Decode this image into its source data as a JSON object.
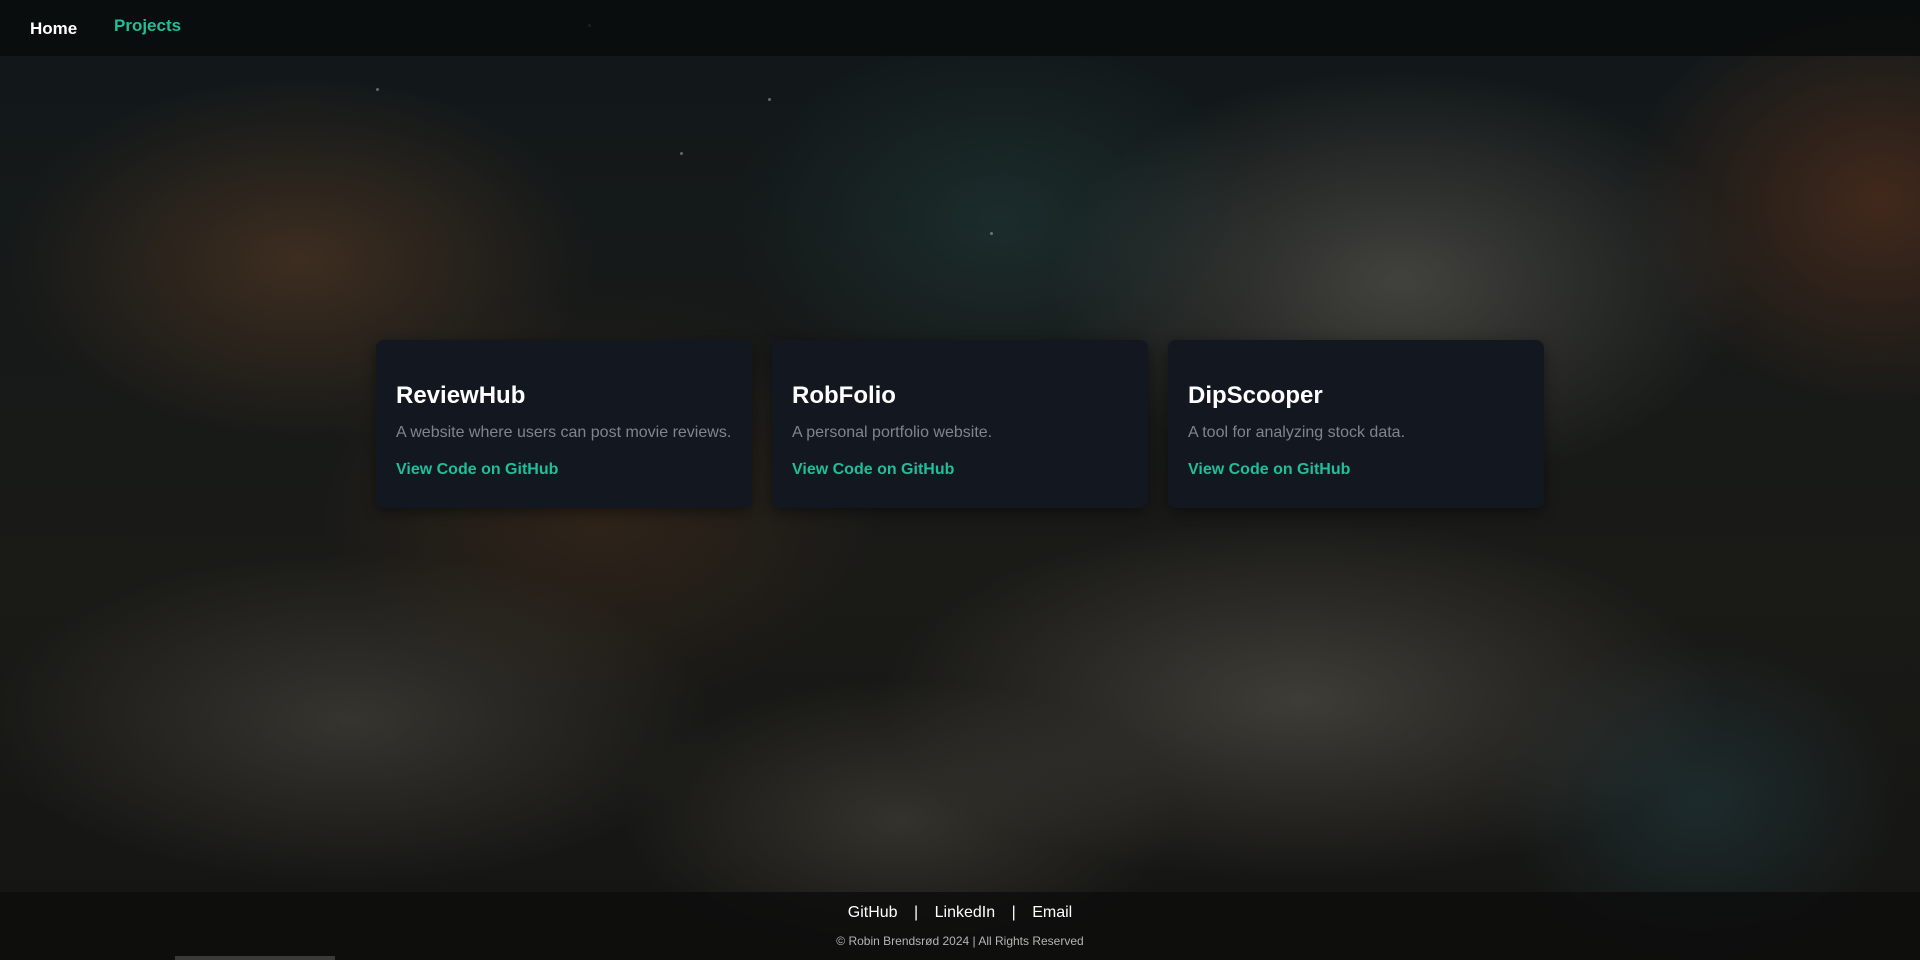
{
  "nav": {
    "home_label": "Home",
    "projects_label": "Projects",
    "projects_color": "#1fbf9a"
  },
  "projects": [
    {
      "title": "ReviewHub",
      "description": "A website where users can post movie reviews.",
      "link_label": "View Code on GitHub"
    },
    {
      "title": "RobFolio",
      "description": "A personal portfolio website.",
      "link_label": "View Code on GitHub"
    },
    {
      "title": "DipScooper",
      "description": "A tool for analyzing stock data.",
      "link_label": "View Code on GitHub"
    }
  ],
  "footer": {
    "links": [
      "GitHub",
      "LinkedIn",
      "Email"
    ],
    "separator": "|",
    "copyright": "© Robin Brendsrød 2024 | All Rights Reserved"
  },
  "colors": {
    "accent": "#1fbf9a",
    "card_bg": "#131820"
  }
}
